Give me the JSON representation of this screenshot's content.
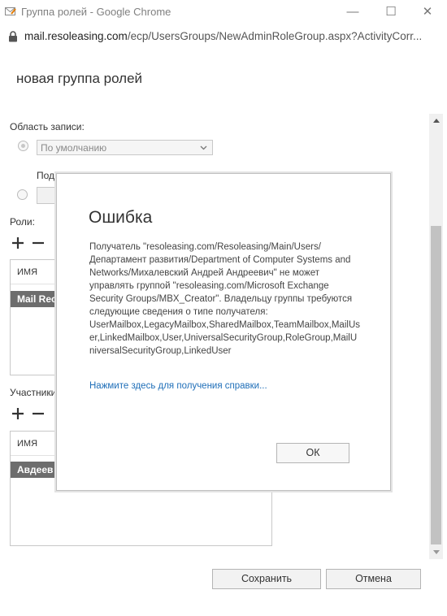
{
  "window": {
    "title": "Группа ролей - Google Chrome",
    "minimize_glyph": "—",
    "maximize_glyph": "☐",
    "close_glyph": "✕"
  },
  "address": {
    "host": "mail.resoleasing.com",
    "path": "/ecp/UsersGroups/NewAdminRoleGroup.aspx?ActivityCorr..."
  },
  "page": {
    "title": "новая группа ролей",
    "write_scope_label": "Область записи:",
    "write_scope_select": "По умолчанию",
    "sub_label": "Подр",
    "roles_label": "Роли:",
    "roles_grid": {
      "column": "ИМЯ",
      "selected_row": "Mail Recipients"
    },
    "members_label": "Участники",
    "members_grid": {
      "column": "ИМЯ",
      "selected_row": "Авдеев А"
    }
  },
  "buttons": {
    "save": "Сохранить",
    "cancel": "Отмена"
  },
  "dialog": {
    "title": "Ошибка",
    "message": "Получатель \"resoleasing.com/Resoleasing/Main/Users/Департамент развития/Department of Computer Systems and Networks/Михалевский Андрей Андреевич\" не может управлять группой \"resoleasing.com/Microsoft Exchange Security Groups/MBX_Creator\". Владельцу группы требуются следующие сведения о типе получателя: UserMailbox,LegacyMailbox,SharedMailbox,TeamMailbox,MailUser,LinkedMailbox,User,UniversalSecurityGroup,RoleGroup,MailUniversalSecurityGroup,LinkedUser",
    "help_link": "Нажмите здесь для получения справки...",
    "ok": "ОК"
  },
  "colors": {
    "link": "#1e6eb8",
    "selected_row": "#6d6d6d"
  }
}
